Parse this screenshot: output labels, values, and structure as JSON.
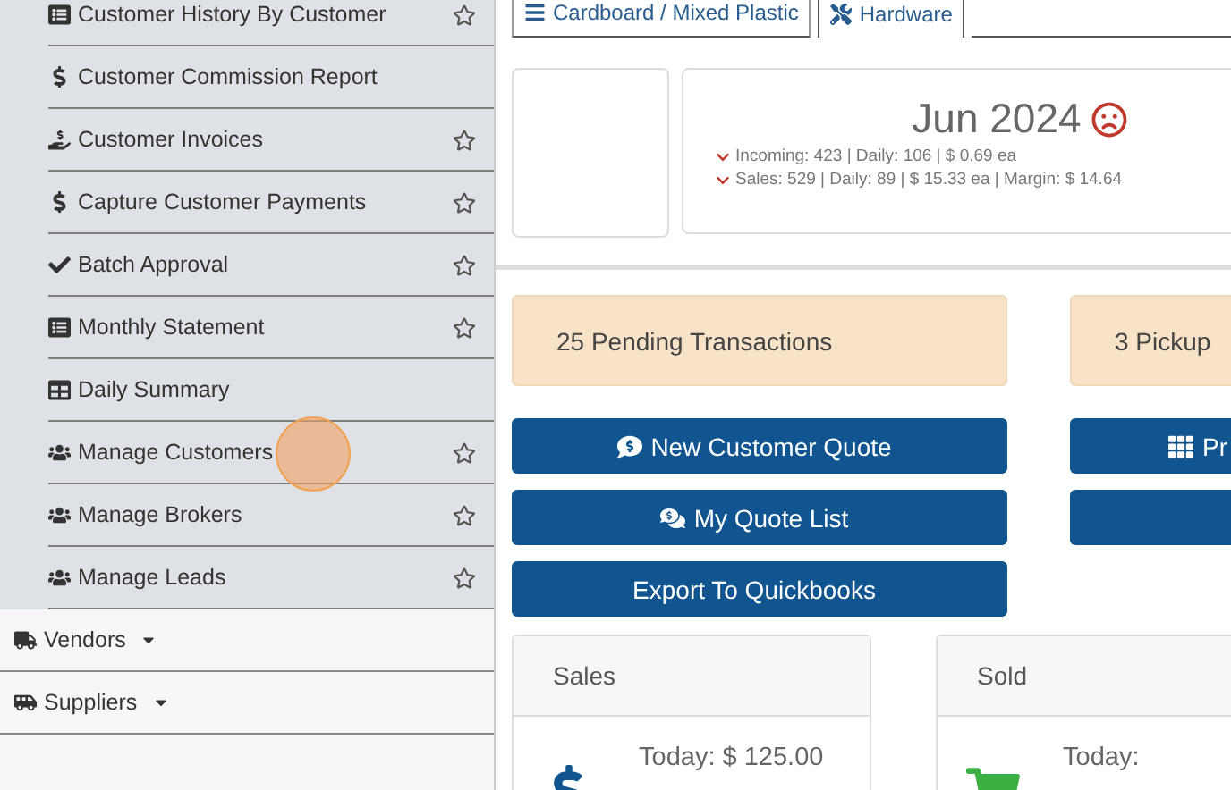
{
  "sidebar": {
    "submenu_items": [
      {
        "label": "Customer History By Customer",
        "star": true,
        "click_marker": false
      },
      {
        "label": "Customer Commission Report",
        "star": false,
        "click_marker": false
      },
      {
        "label": "Customer Invoices",
        "star": true,
        "click_marker": false
      },
      {
        "label": "Capture Customer Payments",
        "star": true,
        "click_marker": false
      },
      {
        "label": "Batch Approval",
        "star": true,
        "click_marker": false
      },
      {
        "label": "Monthly Statement",
        "star": true,
        "click_marker": false
      },
      {
        "label": "Daily Summary",
        "star": false,
        "click_marker": false
      },
      {
        "label": "Manage Customers",
        "star": true,
        "click_marker": true
      },
      {
        "label": "Manage Brokers",
        "star": true,
        "click_marker": false
      },
      {
        "label": "Manage Leads",
        "star": true,
        "click_marker": false
      }
    ],
    "menu_items": [
      {
        "label": "Vendors"
      },
      {
        "label": "Suppliers"
      }
    ]
  },
  "tabs": [
    {
      "label": "Cardboard / Mixed Plastic",
      "selected": false
    },
    {
      "label": "Hardware",
      "selected": true
    }
  ],
  "month_card": {
    "title": "Jun 2024",
    "lines": [
      "Incoming: 423 | Daily: 106 | $ 0.69 ea",
      "Sales: 529 | Daily: 89 | $ 15.33 ea | Margin: $ 14.64"
    ]
  },
  "alerts": [
    "25 Pending Transactions",
    "3 Pickup"
  ],
  "left_buttons": [
    {
      "label": "New Customer Quote"
    },
    {
      "label": "My Quote List"
    },
    {
      "label": "Export To Quickbooks"
    }
  ],
  "right_buttons": [
    {
      "kind": "labeled",
      "label": "Pr"
    },
    {
      "kind": "blank"
    }
  ],
  "stat_cards": [
    {
      "title": "Sales",
      "line": "Today: $ 125.00"
    },
    {
      "title": "Sold",
      "line": "Today:"
    }
  ]
}
